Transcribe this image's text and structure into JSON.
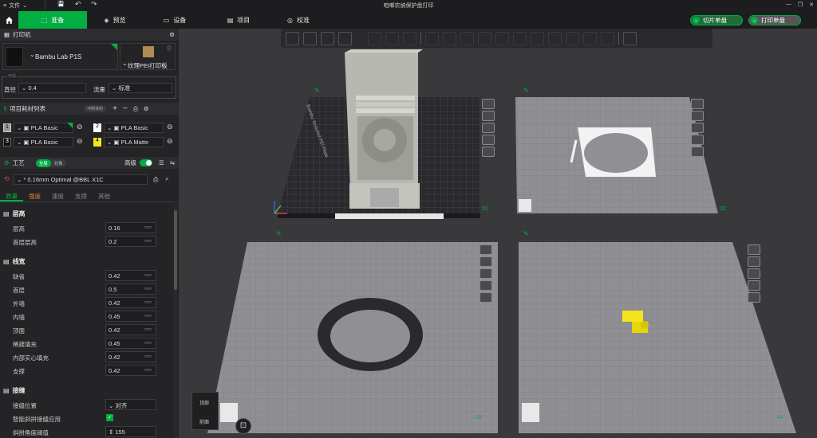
{
  "titlebar": {
    "file_menu": "文件",
    "title": "咱啷农纳保护盘打印"
  },
  "topbar": {
    "tabs": [
      {
        "label": "准备",
        "icon": "cube-icon"
      },
      {
        "label": "预览",
        "icon": "layers-icon"
      },
      {
        "label": "设备",
        "icon": "monitor-icon"
      },
      {
        "label": "项目",
        "icon": "project-icon"
      },
      {
        "label": "校准",
        "icon": "calibrate-icon"
      }
    ],
    "slice_button": "切片单盘",
    "print_button": "打印单盘"
  },
  "printer": {
    "title": "打印机",
    "model": "Bambu Lab P1S",
    "bed": "纹理PEI打印板",
    "nozzle_legend": "喷嘴",
    "diameter_label": "直径",
    "diameter_value": "0.4",
    "flow_label": "流量",
    "flow_value": "标准"
  },
  "filaments": {
    "title": "项目耗材列表",
    "flush_button": "冲刷体积",
    "items": [
      {
        "num": "1",
        "name": "PLA Basic",
        "color": "#9a9a9a"
      },
      {
        "num": "2",
        "name": "PLA Basic",
        "color": "#ffffff"
      },
      {
        "num": "3",
        "name": "PLA Basic",
        "color": "#111111"
      },
      {
        "num": "4",
        "name": "PLA Matte",
        "color": "#f5e51e"
      }
    ]
  },
  "process": {
    "title": "工艺",
    "scope_global": "全局",
    "scope_object": "对象",
    "advanced_label": "高级",
    "preset": "* 0.16mm Optimal @BBL X1C",
    "tabs": [
      "质量",
      "强度",
      "速度",
      "支撑",
      "其他"
    ]
  },
  "quality": {
    "layer_height_title": "层高",
    "layer_height_label": "层高",
    "layer_height_value": "0.16",
    "first_layer_label": "首层层高",
    "first_layer_value": "0.2",
    "line_width_title": "线宽",
    "line_widths": [
      {
        "label": "缺省",
        "value": "0.42"
      },
      {
        "label": "首层",
        "value": "0.5"
      },
      {
        "label": "外墙",
        "value": "0.42"
      },
      {
        "label": "内墙",
        "value": "0.45"
      },
      {
        "label": "顶面",
        "value": "0.42"
      },
      {
        "label": "稀疏填充",
        "value": "0.45"
      },
      {
        "label": "内部实心填充",
        "value": "0.42"
      },
      {
        "label": "支撑",
        "value": "0.42"
      }
    ],
    "unit": "mm",
    "seam_title": "接缝",
    "seam_position_label": "接缝位置",
    "seam_position_value": "对齐",
    "smart_scarf_label": "智能斜拼接缝应用",
    "scarf_angle_label": "斜拼角度阈值",
    "scarf_angle_value": "155"
  },
  "viewport": {
    "plate_numbers": [
      "01",
      "02",
      "03",
      "04"
    ],
    "plate_text": "Bambu Textured PEI Plate",
    "view_top": "顶部",
    "view_front": "前面"
  }
}
